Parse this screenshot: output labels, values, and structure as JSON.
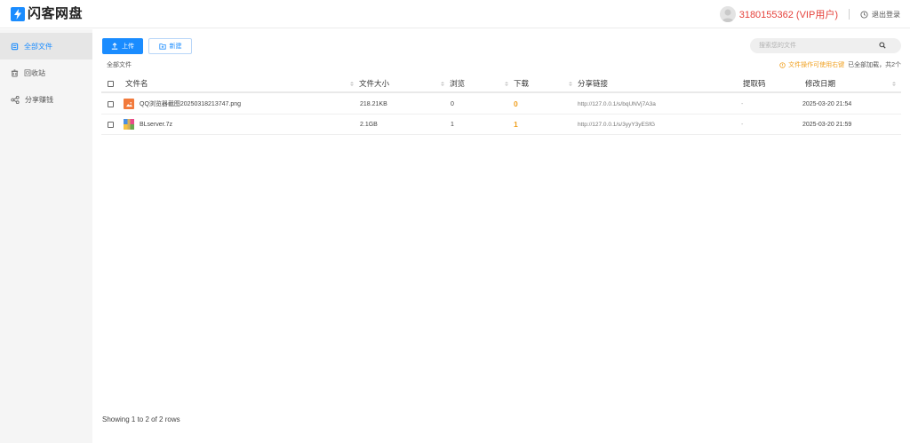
{
  "header": {
    "app_name": "闪客网盘",
    "user_name": "3180155362 (VIP用户)",
    "logout_label": "退出登录"
  },
  "sidebar": {
    "items": [
      {
        "label": "全部文件",
        "icon": "folder-icon",
        "active": true
      },
      {
        "label": "回收站",
        "icon": "trash-icon",
        "active": false
      },
      {
        "label": "分享赚钱",
        "icon": "share-icon",
        "active": false
      }
    ]
  },
  "toolbar": {
    "upload_label": "上传",
    "new_label": "新建",
    "search_placeholder": "搜索您的文件"
  },
  "breadcrumb": "全部文件",
  "tip": {
    "warning": "文件操作可使用右键",
    "loaded": "已全部加载，共2个"
  },
  "table": {
    "columns": {
      "name": "文件名",
      "size": "文件大小",
      "views": "浏览",
      "downloads": "下载",
      "link": "分享链接",
      "code": "提取码",
      "date": "修改日期"
    },
    "rows": [
      {
        "name": "QQ浏览器截图20250318213747.png",
        "size": "218.21KB",
        "views": "0",
        "downloads": "0",
        "link": "http://127.0.0.1/s/bqUNVj7A3a",
        "code": "-",
        "date": "2025-03-20 21:54",
        "icon": "image-file-icon"
      },
      {
        "name": "BLserver.7z",
        "size": "2.1GB",
        "views": "1",
        "downloads": "1",
        "link": "http://127.0.0.1/s/3yyY3yESfG",
        "code": "-",
        "date": "2025-03-20 21:59",
        "icon": "archive-file-icon"
      }
    ]
  },
  "footer": {
    "rows_info": "Showing 1 to 2 of 2 rows"
  },
  "colors": {
    "accent": "#1a8cff",
    "vip_red": "#e5403a",
    "download_orange": "#f0a020"
  }
}
